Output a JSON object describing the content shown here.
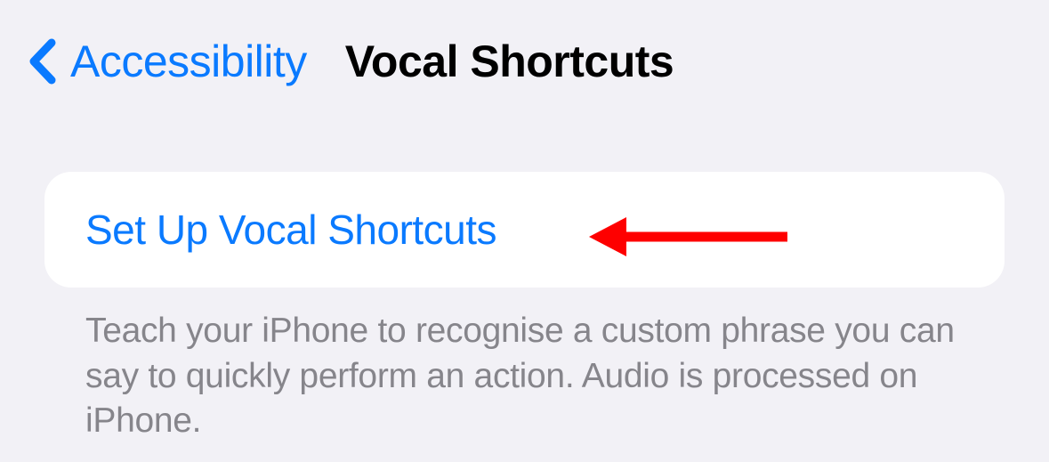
{
  "nav": {
    "back_label": "Accessibility",
    "title": "Vocal Shortcuts"
  },
  "main": {
    "setup_link": "Set Up Vocal Shortcuts",
    "footer": "Teach your iPhone to recognise a custom phrase you can say to quickly perform an action. Audio is processed on iPhone."
  },
  "colors": {
    "accent": "#0a7aff",
    "background": "#f2f1f6",
    "card": "#ffffff",
    "secondary_text": "#86858b",
    "annotation": "#ff0000"
  }
}
